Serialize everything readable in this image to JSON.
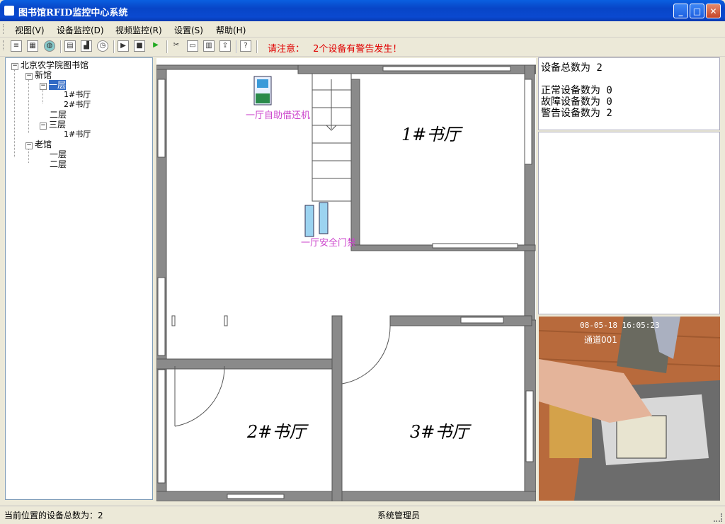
{
  "window": {
    "title": "图书馆RFID监控中心系统"
  },
  "menu": {
    "items": [
      "视图(V)",
      "设备监控(D)",
      "视频监控(R)",
      "设置(S)",
      "帮助(H)"
    ]
  },
  "toolbar": {
    "alert_prefix": "请注意：",
    "alert_message": "2个设备有警告发生！",
    "icons": [
      "list-icon",
      "grid-icon",
      "globe-icon",
      "document-icon",
      "chart-icon",
      "clock-icon",
      "play-step-icon",
      "stop-icon",
      "play-icon",
      "tools-icon",
      "screen-icon",
      "report-icon",
      "export-icon",
      "help-icon"
    ]
  },
  "tree": {
    "root": "北京农学院图书馆",
    "new_building": "新馆",
    "floor1": "一层",
    "hall1": "1#书厅",
    "hall2": "2#书厅",
    "floor2": "二层",
    "floor3": "三层",
    "floor3_hall1": "1#书厅",
    "old_building": "老馆",
    "old_floor1": "一层",
    "old_floor2": "二层"
  },
  "map": {
    "hall1": "1#书厅",
    "hall2": "2#书厅",
    "hall3": "3#书厅",
    "device_kiosk": "一厅自助借还机",
    "device_gate": "一厅安全门禁"
  },
  "summary": {
    "total": "设备总数为 2",
    "normal": "正常设备数为 0",
    "fault": "故障设备数为 0",
    "warning": "警告设备数为 2"
  },
  "video": {
    "timestamp": "08-05-18 16:05:23",
    "channel": "通道001"
  },
  "status": {
    "left": "当前位置的设备总数为：2",
    "center": "系统管理员"
  },
  "colors": {
    "alert": "#e00000",
    "device_label": "#cc44cc",
    "selection": "#316ac5"
  }
}
